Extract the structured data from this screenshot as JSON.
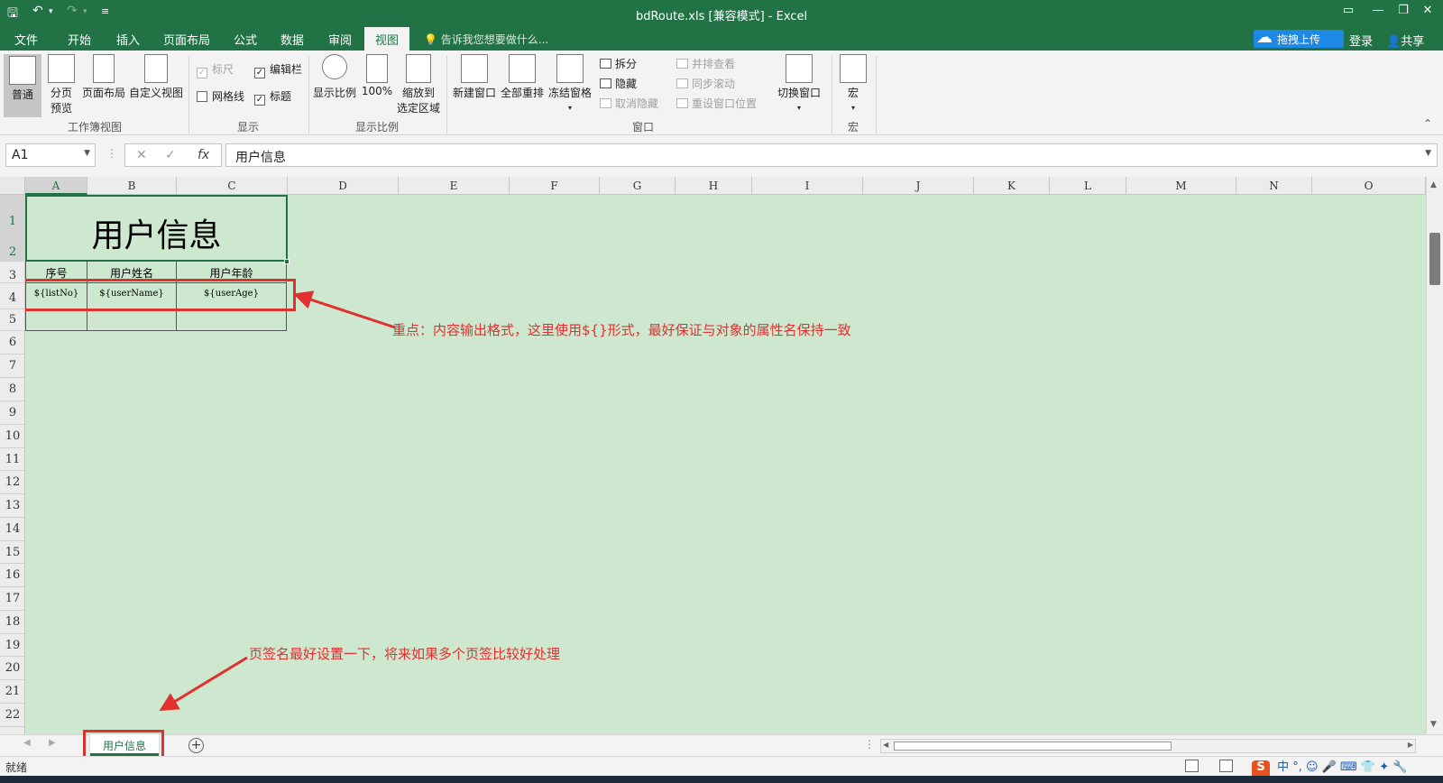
{
  "window": {
    "title": "bdRoute.xls  [兼容模式] - Excel",
    "qat": {
      "save": "🖫",
      "undo": "↶",
      "undo_dd": "▾",
      "redo": "↷",
      "redo_dd": "▾",
      "customize": "≡"
    },
    "controls": {
      "options": "▭",
      "minimize": "—",
      "restore": "❐",
      "close": "✕"
    }
  },
  "ribbon_tabs": [
    "文件",
    "开始",
    "插入",
    "页面布局",
    "公式",
    "数据",
    "审阅",
    "视图"
  ],
  "active_tab": "视图",
  "tell_me": "告诉我您想要做什么...",
  "account": {
    "upload": "拖拽上传",
    "login": "登录",
    "share": "共享"
  },
  "ribbon": {
    "workbook_views": {
      "label": "工作簿视图",
      "normal": "普通",
      "page_break_1": "分页",
      "page_break_2": "预览",
      "page_layout": "页面布局",
      "custom": "自定义视图"
    },
    "show": {
      "label": "显示",
      "ruler": "标尺",
      "formula_bar": "编辑栏",
      "gridlines": "网格线",
      "headings": "标题"
    },
    "zoom": {
      "label": "显示比例",
      "zoom": "显示比例",
      "hundred": "100%",
      "fit_1": "缩放到",
      "fit_2": "选定区域"
    },
    "window": {
      "label": "窗口",
      "new_window": "新建窗口",
      "arrange_all": "全部重排",
      "freeze": "冻结窗格",
      "split": "拆分",
      "hide": "隐藏",
      "unhide": "取消隐藏",
      "side_by_side": "并排查看",
      "sync_scroll": "同步滚动",
      "reset_pos": "重设窗口位置",
      "switch": "切换窗口"
    },
    "macros": {
      "label": "宏",
      "macros": "宏"
    }
  },
  "formula_bar": {
    "name_box": "A1",
    "cancel": "✕",
    "enter": "✓",
    "fx": "fx",
    "content": "用户信息"
  },
  "columns": [
    "A",
    "B",
    "C",
    "D",
    "E",
    "F",
    "G",
    "H",
    "I",
    "J",
    "K",
    "L",
    "M",
    "N",
    "O"
  ],
  "selected_column": "A",
  "rows": [
    "1",
    "2",
    "3",
    "4",
    "5",
    "6",
    "7",
    "8",
    "9",
    "10",
    "11",
    "12",
    "13",
    "14",
    "15",
    "16",
    "17",
    "18",
    "19",
    "20",
    "21",
    "22"
  ],
  "sheet": {
    "title_cell": "用户信息",
    "headers": [
      "序号",
      "用户姓名",
      "用户年龄"
    ],
    "template_row": [
      "${listNo}",
      "${userName}",
      "${userAge}"
    ]
  },
  "annotations": {
    "note1": "重点：内容输出格式，这里使用${}形式，最好保证与对象的属性名保持一致",
    "note2": "页签名最好设置一下，将来如果多个页签比较好处理"
  },
  "sheet_tabs": [
    "用户信息"
  ],
  "add_sheet": "+",
  "status": {
    "ready": "就绪",
    "ime": "中 °, ☺ 🎤 ⌨ 👕 ✦ 🔧"
  },
  "colors": {
    "excel_green": "#217346",
    "grid_bg": "#cde8cf",
    "annotation_red": "#e03030"
  }
}
